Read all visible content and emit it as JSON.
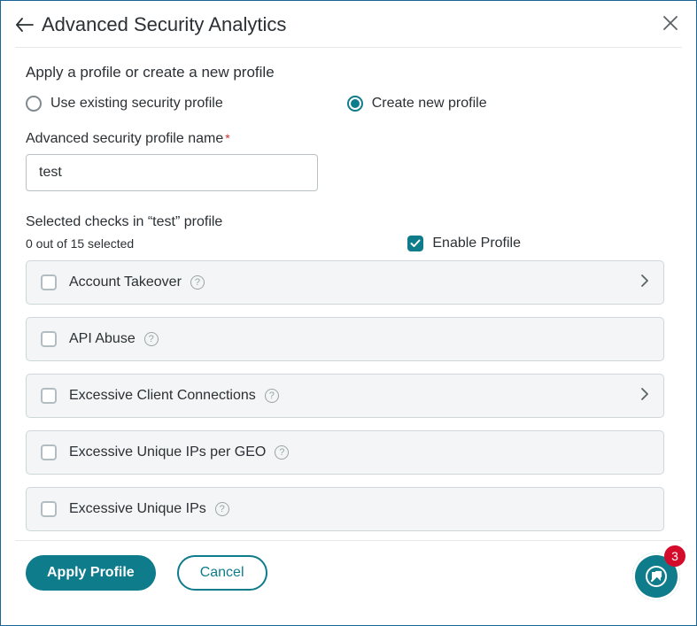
{
  "header": {
    "title": "Advanced Security Analytics"
  },
  "profile": {
    "prompt": "Apply a profile or create a new profile",
    "existing_label": "Use existing security profile",
    "existing_selected": false,
    "create_label": "Create new profile",
    "create_selected": true,
    "name_label": "Advanced security profile name",
    "name_value": "test"
  },
  "checks": {
    "title": "Selected checks in “test” profile",
    "count_text": "0 out of 15 selected",
    "enable_label": "Enable Profile",
    "enable_checked": true,
    "items": [
      {
        "name": "Account Takeover",
        "checked": false,
        "expandable": true
      },
      {
        "name": "API Abuse",
        "checked": false,
        "expandable": false
      },
      {
        "name": "Excessive Client Connections",
        "checked": false,
        "expandable": true
      },
      {
        "name": "Excessive Unique IPs per GEO",
        "checked": false,
        "expandable": false
      },
      {
        "name": "Excessive Unique IPs",
        "checked": false,
        "expandable": false
      }
    ]
  },
  "footer": {
    "apply_label": "Apply Profile",
    "cancel_label": "Cancel"
  },
  "fab": {
    "badge": "3"
  }
}
